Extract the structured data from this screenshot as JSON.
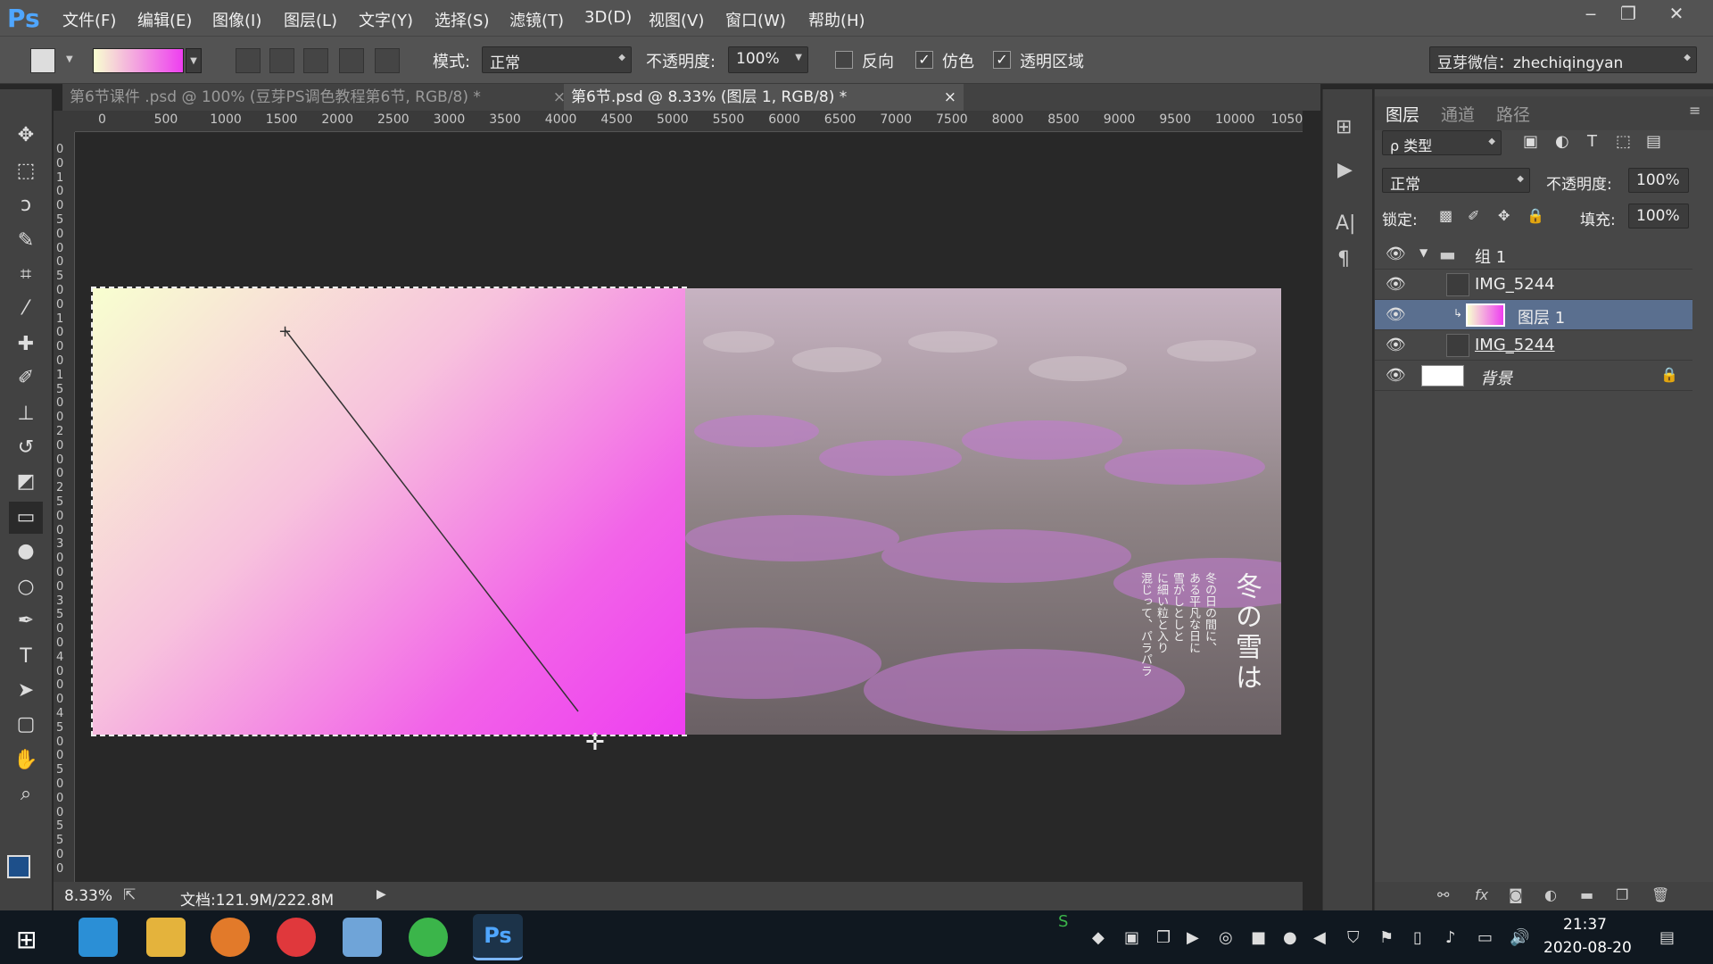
{
  "app": {
    "logo": "Ps"
  },
  "menu": [
    "文件(F)",
    "编辑(E)",
    "图像(I)",
    "图层(L)",
    "文字(Y)",
    "选择(S)",
    "滤镜(T)",
    "3D(D)",
    "视图(V)",
    "窗口(W)",
    "帮助(H)"
  ],
  "options": {
    "mode_label": "模式:",
    "mode_value": "正常",
    "opacity_label": "不透明度:",
    "opacity_value": "100%",
    "reverse_label": "反向",
    "dither_label": "仿色",
    "transparency_label": "透明区域",
    "workspace_value": "豆芽微信：zhechiqingyan"
  },
  "tabs": [
    {
      "label": "第6节课件 .psd @ 100% (豆芽PS调色教程第6节, RGB/8) *",
      "close": "×"
    },
    {
      "label": "第6节.psd @ 8.33% (图层 1, RGB/8) *",
      "close": "×"
    }
  ],
  "ruler": {
    "h_ticks": [
      "0",
      "500",
      "1000",
      "1500",
      "2000",
      "2500",
      "3000",
      "3500",
      "4000",
      "4500",
      "5000",
      "5500",
      "6000",
      "6500",
      "7000",
      "7500",
      "8000",
      "8500",
      "9000",
      "9500",
      "10000",
      "1050"
    ],
    "v_ticks": [
      "0",
      "0",
      "1",
      "0",
      "0",
      "5",
      "0",
      "0",
      "0",
      "5",
      "0",
      "0",
      "1",
      "0",
      "0",
      "0",
      "1",
      "5",
      "0",
      "0",
      "2",
      "0",
      "0",
      "0",
      "2",
      "5",
      "0",
      "0",
      "3",
      "0",
      "0",
      "0",
      "3",
      "5",
      "0",
      "0",
      "4",
      "0",
      "0",
      "0",
      "4",
      "5",
      "0",
      "0",
      "5",
      "0",
      "0",
      "0",
      "5",
      "5",
      "0",
      "0"
    ]
  },
  "artwork_text": {
    "title": "冬の雪は",
    "line1": "冬の日の間に、",
    "line2": "ある平凡な日に",
    "line3": "雪がしとしと",
    "line4": "に細い粒と入り",
    "line5": "混じって、パラパラ"
  },
  "status": {
    "zoom": "8.33%",
    "doc": "文档:121.9M/222.8M"
  },
  "panel": {
    "tabs": [
      "图层",
      "通道",
      "路径"
    ],
    "filter": "ρ 类型",
    "blend": "正常",
    "opacity_label": "不透明度:",
    "opacity_value": "100%",
    "lock_label": "锁定:",
    "fill_label": "填充:",
    "fill_value": "100%"
  },
  "layers": [
    {
      "name": "组 1"
    },
    {
      "name": "IMG_5244"
    },
    {
      "name": "图层 1"
    },
    {
      "name": "IMG_5244"
    },
    {
      "name": "背景"
    }
  ],
  "taskbar": {
    "time": "21:37",
    "date": "2020-08-20"
  },
  "colors": {
    "accent": "#4fa6ff",
    "selected_layer": "#5a6f8f",
    "gradient_start": "#f8ffd0",
    "gradient_end": "#ee3ef0"
  }
}
